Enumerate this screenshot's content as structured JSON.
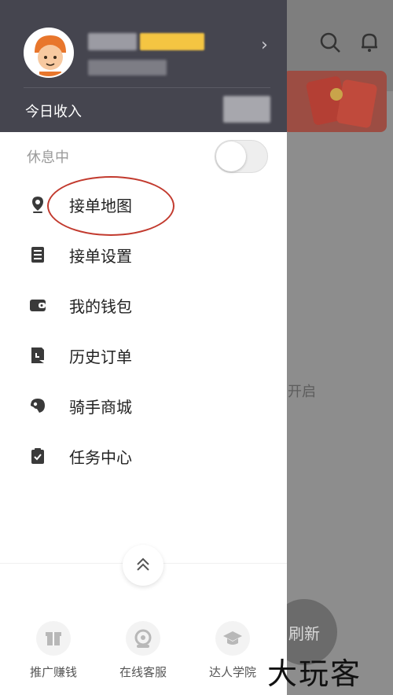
{
  "header": {
    "income_label": "今日收入"
  },
  "status": {
    "label": "休息中",
    "online": false
  },
  "menu": [
    {
      "label": "接单地图",
      "icon": "map-pin-icon"
    },
    {
      "label": "接单设置",
      "icon": "settings-list-icon"
    },
    {
      "label": "我的钱包",
      "icon": "wallet-icon"
    },
    {
      "label": "历史订单",
      "icon": "history-order-icon"
    },
    {
      "label": "骑手商城",
      "icon": "shop-icon"
    },
    {
      "label": "任务中心",
      "icon": "task-clipboard-icon"
    }
  ],
  "footer": [
    {
      "label": "推广赚钱",
      "icon": "gift-icon"
    },
    {
      "label": "在线客服",
      "icon": "customer-service-icon"
    },
    {
      "label": "达人学院",
      "icon": "graduation-cap-icon"
    }
  ],
  "background": {
    "hint_text": "开启",
    "fab_text": "刷新"
  },
  "watermark": "大玩客",
  "colors": {
    "header_bg": "#45454f",
    "highlight": "#c23a2e",
    "badge": "#f4c542"
  }
}
